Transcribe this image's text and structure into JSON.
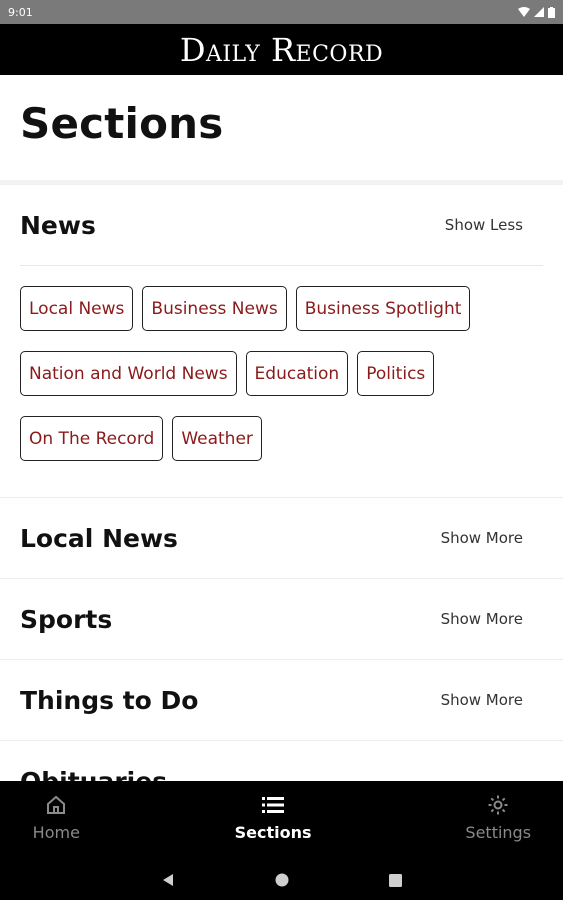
{
  "status_bar": {
    "time": "9:01"
  },
  "header": {
    "masthead": "Daily Record"
  },
  "page": {
    "title": "Sections"
  },
  "sections": [
    {
      "title": "News",
      "toggle": "Show Less",
      "expanded": true,
      "chips": [
        [
          "Local News",
          "Business News",
          "Business Spotlight"
        ],
        [
          "Nation and World News",
          "Education",
          "Politics"
        ],
        [
          "On The Record",
          "Weather"
        ]
      ]
    },
    {
      "title": "Local News",
      "toggle": "Show More",
      "expanded": false
    },
    {
      "title": "Sports",
      "toggle": "Show More",
      "expanded": false
    },
    {
      "title": "Things to Do",
      "toggle": "Show More",
      "expanded": false
    },
    {
      "title": "Obituaries",
      "toggle": "",
      "expanded": false
    }
  ],
  "bottom_nav": {
    "items": [
      {
        "label": "Home",
        "icon": "home-icon",
        "active": false
      },
      {
        "label": "Sections",
        "icon": "list-icon",
        "active": true
      },
      {
        "label": "Settings",
        "icon": "gear-icon",
        "active": false
      }
    ]
  },
  "colors": {
    "chip_text": "#8b1a1a",
    "header_bg": "#000000",
    "active_nav": "#ffffff",
    "inactive_nav": "#8a8a8a"
  }
}
